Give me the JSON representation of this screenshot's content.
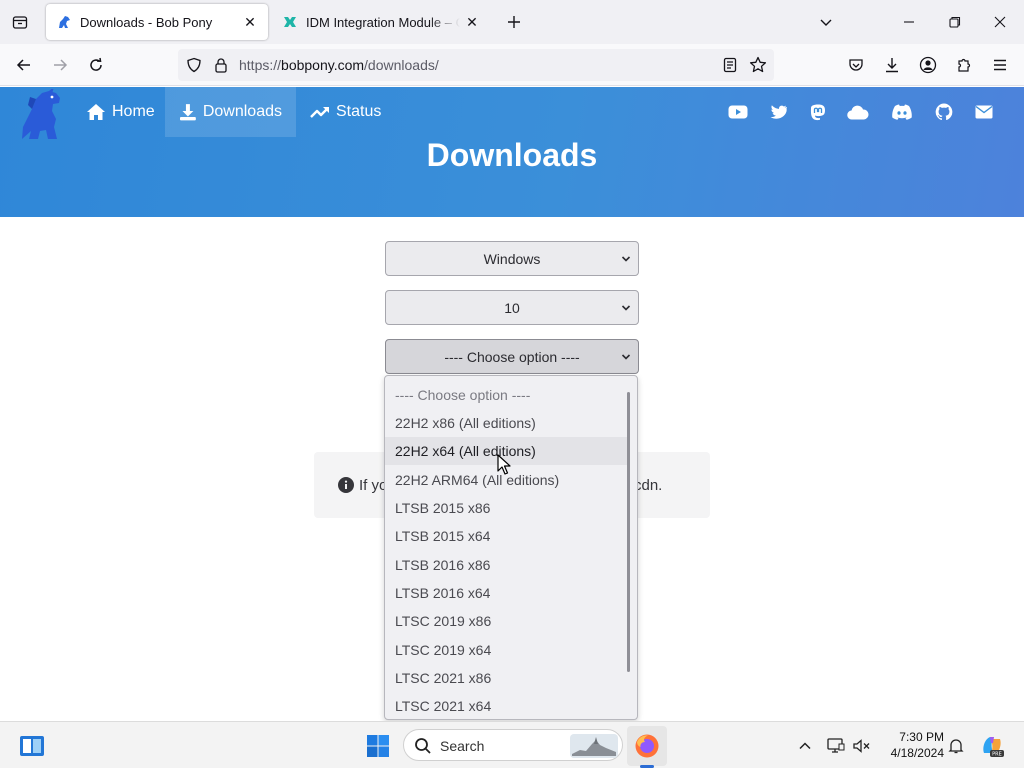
{
  "browser": {
    "tabs": [
      {
        "title": "Downloads - Bob Pony",
        "active": true
      },
      {
        "title": "IDM Integration Module – Get the",
        "active": false
      }
    ],
    "url": {
      "scheme": "https://",
      "host": "bobpony.com",
      "path": "/downloads/"
    }
  },
  "site": {
    "nav": [
      {
        "label": "Home",
        "icon": "home-icon"
      },
      {
        "label": "Downloads",
        "icon": "download-icon",
        "active": true
      },
      {
        "label": "Status",
        "icon": "trending-up-icon"
      }
    ],
    "social_icons": [
      "youtube-icon",
      "twitter-icon",
      "mastodon-icon",
      "cloud-icon",
      "discord-icon",
      "github-icon",
      "mail-icon"
    ],
    "accent_color": "#3b8fd9"
  },
  "main": {
    "heading": "Downloads",
    "selects": {
      "os": "Windows",
      "version": "10",
      "option": "---- Choose option ----"
    },
    "notice": {
      "left_text": "If yo",
      "right_text": "cdn."
    },
    "dropdown": {
      "placeholder": "---- Choose option ----",
      "options": [
        "22H2 x86 (All editions)",
        "22H2 x64 (All editions)",
        "22H2 ARM64 (All editions)",
        "LTSB 2015 x86",
        "LTSB 2015 x64",
        "LTSB 2016 x86",
        "LTSB 2016 x64",
        "LTSC 2019 x86",
        "LTSC 2019 x64",
        "LTSC 2021 x86",
        "LTSC 2021 x64"
      ],
      "hovered": "22H2 x64 (All editions)"
    }
  },
  "taskbar": {
    "search_label": "Search",
    "time": "7:30 PM",
    "date": "4/18/2024"
  }
}
